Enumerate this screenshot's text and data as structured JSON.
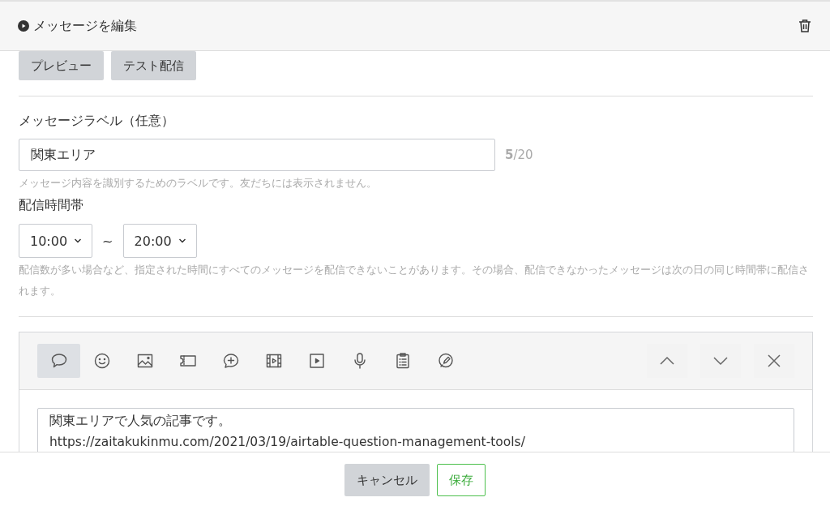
{
  "header": {
    "title": "メッセージを編集"
  },
  "actions": [
    "プレビュー",
    "テスト配信"
  ],
  "label_field": {
    "label": "メッセージラベル（任意）",
    "value": "関東エリア",
    "counter": "**5**/20",
    "hint": "メッセージ内容を識別するためのラベルです。友だちには表示されません。"
  },
  "delivery_time": {
    "label": "配信時間帯",
    "start": "10:00",
    "separator": "~",
    "end": "20:00",
    "hint": "配信数が多い場合など、指定された時間にすべてのメッセージを配信できないことがあります。その場合、配信できなかったメッセージは次の日の同じ時間帯に配信されます。"
  },
  "editor": {
    "tools": [
      {
        "kind": "text",
        "selected": true
      },
      {
        "kind": "sticker",
        "selected": false
      },
      {
        "kind": "image",
        "selected": false
      },
      {
        "kind": "coupon",
        "selected": false
      },
      {
        "kind": "richmessage",
        "selected": false
      },
      {
        "kind": "richvideo",
        "selected": false
      },
      {
        "kind": "video",
        "selected": false
      },
      {
        "kind": "voice",
        "selected": false
      },
      {
        "kind": "survey",
        "selected": false
      },
      {
        "kind": "card",
        "selected": false
      }
    ],
    "value": "関東エリアで人気の記事です。\nhttps://zaitakukinmu.com/2021/03/19/airtable-question-management-tools/"
  },
  "footer": {
    "cancel": "キャンセル",
    "save": "保存"
  }
}
